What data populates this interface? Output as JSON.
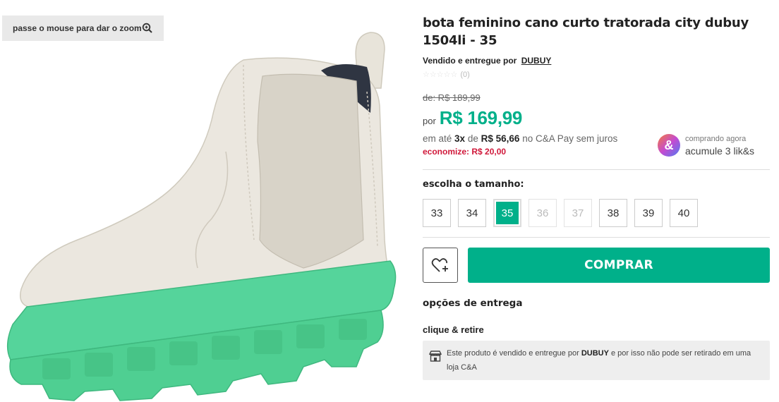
{
  "gallery": {
    "zoom_hint": "passe o mouse para dar o zoom",
    "zoom_icon": "zoom-in-icon",
    "colors": {
      "boot_body": "#e9e5dc",
      "sole": "#4fcf92",
      "sole_dark": "#3fb87f"
    }
  },
  "product": {
    "title": "bota feminino cano curto tratorada city dubuy 1504li - 35",
    "seller_prefix": "Vendido e entregue por",
    "seller_name": "DUBUY",
    "rating_stars": "☆☆☆☆☆",
    "rating_count": "(0)"
  },
  "price": {
    "old": "de: R$ 189,99",
    "por": "por",
    "current": "R$ 169,99",
    "inst_prefix": "em até",
    "inst_count": "3x",
    "inst_de": "de",
    "inst_value": "R$ 56,66",
    "inst_suffix": "no C&A Pay sem juros",
    "savings": "economize: R$ 20,00"
  },
  "cashback": {
    "logo": "&",
    "line1": "comprando agora",
    "line2": "acumule 3 lik&s"
  },
  "sizes": {
    "label": "escolha o tamanho:",
    "options": [
      {
        "value": "33",
        "state": "available"
      },
      {
        "value": "34",
        "state": "available"
      },
      {
        "value": "35",
        "state": "selected"
      },
      {
        "value": "36",
        "state": "unavailable"
      },
      {
        "value": "37",
        "state": "unavailable"
      },
      {
        "value": "38",
        "state": "available"
      },
      {
        "value": "39",
        "state": "available"
      },
      {
        "value": "40",
        "state": "available"
      }
    ]
  },
  "actions": {
    "wishlist_icon": "heart-plus-icon",
    "buy_label": "COMPRAR"
  },
  "delivery": {
    "title": "opções de entrega",
    "pickup_title": "clique & retire",
    "store_icon": "store-icon",
    "notice_prefix": "Este produto é vendido e entregue por",
    "notice_seller": "DUBUY",
    "notice_suffix": "e por isso não pode ser retirado em uma loja C&A"
  },
  "colors": {
    "accent": "#00b08a",
    "savings": "#d0183a"
  }
}
